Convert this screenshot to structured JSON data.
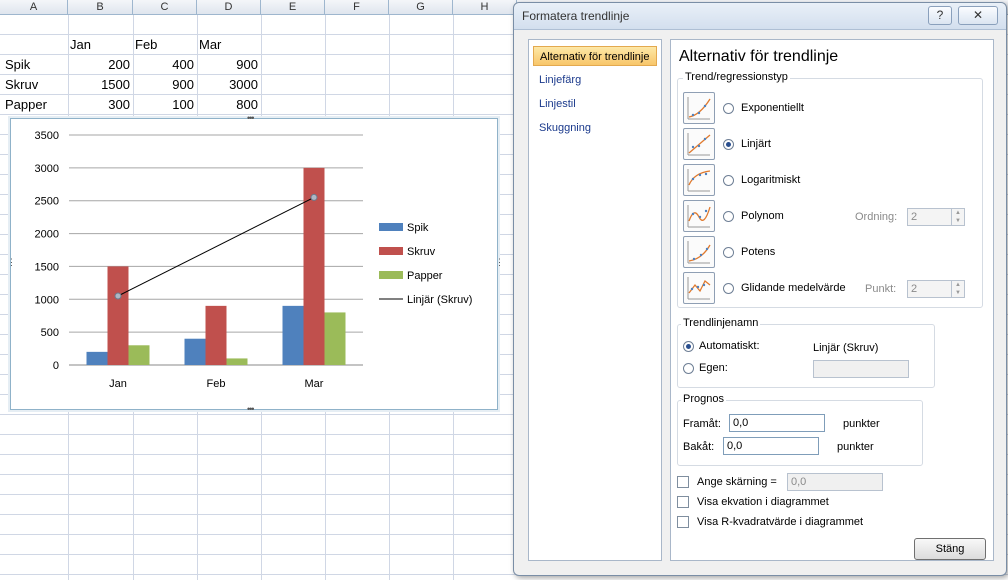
{
  "spreadsheet": {
    "columns": [
      "A",
      "B",
      "C",
      "D",
      "E",
      "F",
      "G",
      "H"
    ],
    "header_row": [
      "",
      "Jan",
      "Feb",
      "Mar"
    ],
    "rows": [
      {
        "label": "Spik",
        "values": [
          "200",
          "400",
          "900"
        ]
      },
      {
        "label": "Skruv",
        "values": [
          "1500",
          "900",
          "3000"
        ]
      },
      {
        "label": "Papper",
        "values": [
          "300",
          "100",
          "800"
        ]
      }
    ]
  },
  "chart_data": {
    "type": "bar",
    "categories": [
      "Jan",
      "Feb",
      "Mar"
    ],
    "series": [
      {
        "name": "Spik",
        "values": [
          200,
          400,
          900
        ],
        "color": "#4f81bd"
      },
      {
        "name": "Skruv",
        "values": [
          1500,
          900,
          3000
        ],
        "color": "#c0504d"
      },
      {
        "name": "Papper",
        "values": [
          300,
          100,
          800
        ],
        "color": "#9bbb59"
      }
    ],
    "trendline": {
      "name": "Linjär (Skruv)",
      "type": "linear",
      "series": "Skruv",
      "start": 1050,
      "end": 2550,
      "color": "#000000"
    },
    "yticks": [
      "0",
      "500",
      "1000",
      "1500",
      "2000",
      "2500",
      "3000",
      "3500"
    ],
    "ylim": [
      0,
      3500
    ],
    "grid": true,
    "legend_position": "right"
  },
  "dialog": {
    "title": "Formatera trendlinje",
    "help_label": "?",
    "close_label": "✕",
    "nav": [
      {
        "label": "Alternativ för trendlinje",
        "selected": true
      },
      {
        "label": "Linjefärg",
        "selected": false
      },
      {
        "label": "Linjestil",
        "selected": false
      },
      {
        "label": "Skuggning",
        "selected": false
      }
    ],
    "panel_title": "Alternativ för trendlinje",
    "type_group": {
      "label": "Trend/regressionstyp",
      "options": [
        {
          "label": "Exponentiellt",
          "icon": "exponential-trend-icon",
          "selected": false
        },
        {
          "label": "Linjärt",
          "icon": "linear-trend-icon",
          "selected": true
        },
        {
          "label": "Logaritmiskt",
          "icon": "logarithmic-trend-icon",
          "selected": false
        },
        {
          "label": "Polynom",
          "icon": "polynomial-trend-icon",
          "selected": false
        },
        {
          "label": "Potens",
          "icon": "power-trend-icon",
          "selected": false
        },
        {
          "label": "Glidande medelvärde",
          "icon": "moving-average-trend-icon",
          "selected": false
        }
      ],
      "order_label": "Ordning:",
      "order_value": "2",
      "period_label": "Punkt:",
      "period_value": "2"
    },
    "name_group": {
      "label": "Trendlinjenamn",
      "auto_label": "Automatiskt:",
      "auto_value": "Linjär (Skruv)",
      "custom_label": "Egen:",
      "custom_value": ""
    },
    "forecast_group": {
      "label": "Prognos",
      "forward_label": "Framåt:",
      "forward_value": "0,0",
      "backward_label": "Bakåt:",
      "backward_value": "0,0",
      "unit": "punkter"
    },
    "intercept_label": "Ange skärning =",
    "intercept_value": "0,0",
    "show_equation_label": "Visa ekvation i diagrammet",
    "show_r2_label": "Visa R-kvadratvärde i diagrammet",
    "close_button": "Stäng"
  }
}
